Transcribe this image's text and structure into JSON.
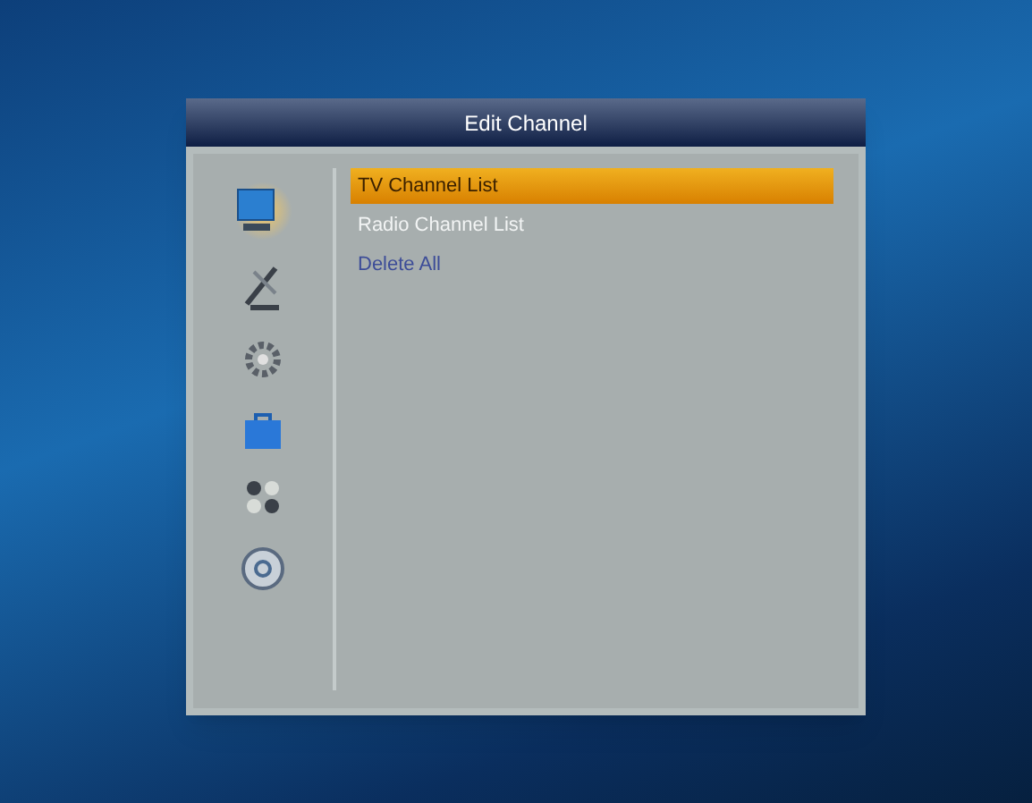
{
  "window": {
    "title": "Edit Channel"
  },
  "sidebar": {
    "items": [
      {
        "selected": true
      },
      {
        "selected": false
      },
      {
        "selected": false
      },
      {
        "selected": false
      },
      {
        "selected": false
      },
      {
        "selected": false
      }
    ]
  },
  "menu": {
    "items": [
      {
        "label": "TV Channel List",
        "selected": true,
        "disabled": false
      },
      {
        "label": "Radio Channel List",
        "selected": false,
        "disabled": true
      },
      {
        "label": "Delete All",
        "selected": false,
        "disabled": false
      }
    ]
  }
}
